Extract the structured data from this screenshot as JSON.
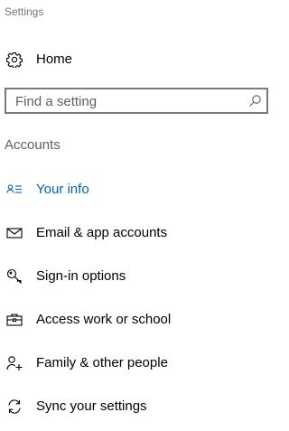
{
  "window": {
    "title": "Settings"
  },
  "home": {
    "label": "Home",
    "icon": "gear-icon"
  },
  "search": {
    "placeholder": "Find a setting",
    "value": "",
    "icon": "search-icon"
  },
  "section": {
    "title": "Accounts"
  },
  "colors": {
    "accent": "#0063b1",
    "text": "#000000",
    "muted": "#5f5f5f",
    "border": "#7a7a7a"
  },
  "nav": {
    "items": [
      {
        "label": "Your info",
        "icon": "contact-card-icon",
        "active": true
      },
      {
        "label": "Email & app accounts",
        "icon": "mail-icon",
        "active": false
      },
      {
        "label": "Sign-in options",
        "icon": "key-icon",
        "active": false
      },
      {
        "label": "Access work or school",
        "icon": "briefcase-icon",
        "active": false
      },
      {
        "label": "Family & other people",
        "icon": "add-person-icon",
        "active": false
      },
      {
        "label": "Sync your settings",
        "icon": "sync-icon",
        "active": false
      }
    ]
  }
}
